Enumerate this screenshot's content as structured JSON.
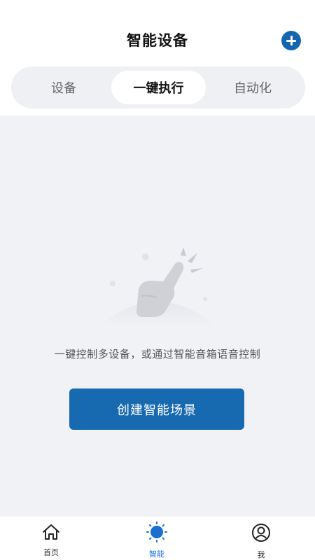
{
  "header": {
    "title": "智能设备"
  },
  "tabs": [
    {
      "label": "设备"
    },
    {
      "label": "一键执行"
    },
    {
      "label": "自动化"
    }
  ],
  "empty_state": {
    "message": "一键控制多设备，或通过智能音箱语音控制",
    "button_label": "创建智能场景"
  },
  "bottom_nav": [
    {
      "label": "首页",
      "icon": "home-icon"
    },
    {
      "label": "智能",
      "icon": "sun-icon"
    },
    {
      "label": "我",
      "icon": "user-icon"
    }
  ],
  "colors": {
    "accent": "#1769b0",
    "nav_active": "#1a6fd0",
    "page_background": "#f1f2f6"
  }
}
